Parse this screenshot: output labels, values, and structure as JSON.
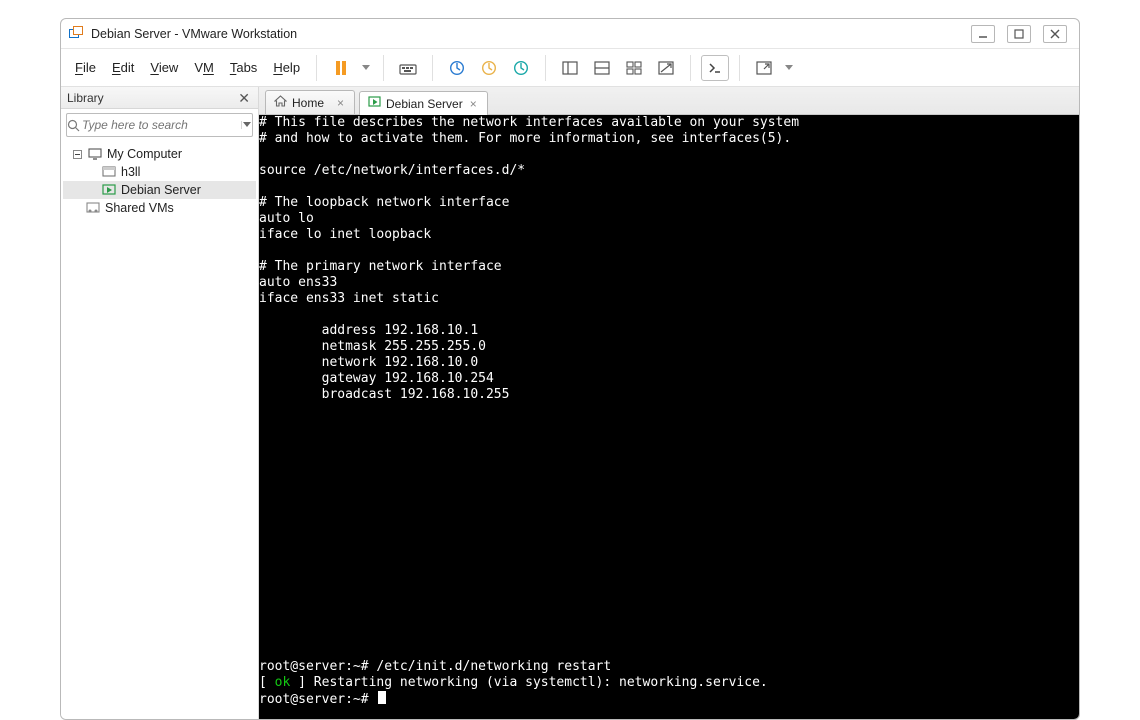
{
  "window": {
    "title": "Debian Server - VMware Workstation"
  },
  "menu": {
    "items": [
      {
        "key": "F",
        "rest": "ile",
        "name": "File"
      },
      {
        "key": "E",
        "rest": "dit",
        "name": "Edit"
      },
      {
        "key": "V",
        "rest": "iew",
        "name": "View"
      },
      {
        "key": "V",
        "rest": "M",
        "name": "VM",
        "pre": "V",
        "post": ""
      },
      {
        "key": "T",
        "rest": "abs",
        "name": "Tabs"
      },
      {
        "key": "H",
        "rest": "elp",
        "name": "Help"
      }
    ]
  },
  "library": {
    "title": "Library",
    "search_placeholder": "Type here to search",
    "tree": {
      "root": "My Computer",
      "children": [
        {
          "label": "h3ll",
          "selected": false
        },
        {
          "label": "Debian Server",
          "selected": true
        }
      ],
      "shared": "Shared VMs"
    }
  },
  "tabs": [
    {
      "label": "Home",
      "icon": "home",
      "active": false
    },
    {
      "label": "Debian Server",
      "icon": "vm",
      "active": true
    }
  ],
  "terminal": {
    "lines": [
      "# This file describes the network interfaces available on your system",
      "# and how to activate them. For more information, see interfaces(5).",
      "",
      "source /etc/network/interfaces.d/*",
      "",
      "# The loopback network interface",
      "auto lo",
      "iface lo inet loopback",
      "",
      "# The primary network interface",
      "auto ens33",
      "iface ens33 inet static",
      "",
      "        address 192.168.10.1",
      "        netmask 255.255.255.0",
      "        network 192.168.10.0",
      "        gateway 192.168.10.254",
      "        broadcast 192.168.10.255"
    ],
    "blank_lines_after": 16,
    "cmd_prompt1": "root@server:~# ",
    "cmd1": "/etc/init.d/networking restart",
    "status_pre": "[ ",
    "status_ok": "ok",
    "status_post": " ] Restarting networking (via systemctl): networking.service.",
    "cmd_prompt2": "root@server:~# "
  }
}
